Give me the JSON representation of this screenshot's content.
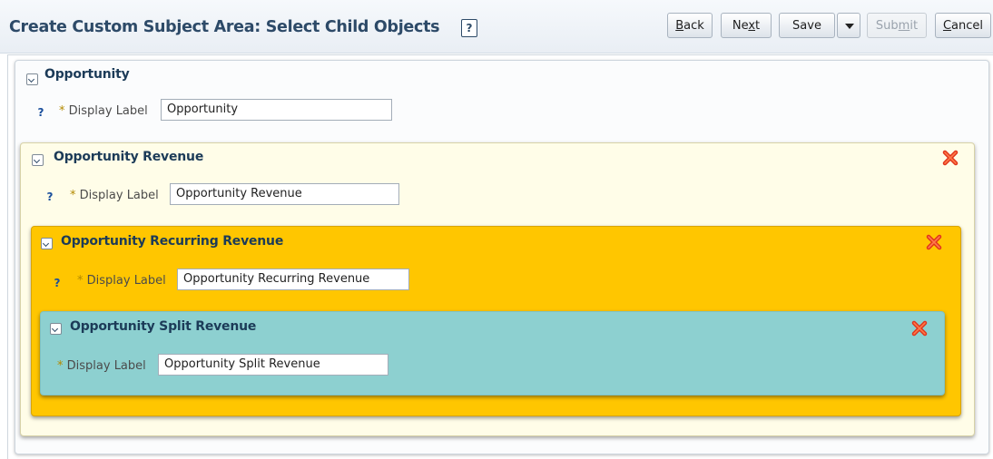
{
  "header": {
    "title": "Create Custom Subject Area: Select Child Objects",
    "help_label": "?",
    "buttons": {
      "back": {
        "label_pre": "",
        "label_u": "B",
        "label_post": "ack"
      },
      "next": {
        "label_pre": "Ne",
        "label_u": "x",
        "label_post": "t"
      },
      "save": {
        "label": "Save"
      },
      "submit": {
        "label_pre": "Sub",
        "label_u": "m",
        "label_post": "it"
      },
      "cancel": {
        "label_pre": "",
        "label_u": "C",
        "label_post": "ancel"
      }
    }
  },
  "field_label": "Display Label",
  "required_marker": "*",
  "help_marker": "?",
  "panels": [
    {
      "title": "Opportunity",
      "value": "Opportunity",
      "color": "#fbfcfd"
    },
    {
      "title": "Opportunity Revenue",
      "value": "Opportunity Revenue",
      "color": "#fffde8"
    },
    {
      "title": "Opportunity Recurring Revenue",
      "value": "Opportunity Recurring Revenue",
      "color": "#ffc600"
    },
    {
      "title": "Opportunity Split Revenue",
      "value": "Opportunity Split Revenue",
      "color": "#8dd0d0"
    }
  ],
  "colors": {
    "title": "#2d4a68",
    "remove_icon": "#e0341b"
  }
}
